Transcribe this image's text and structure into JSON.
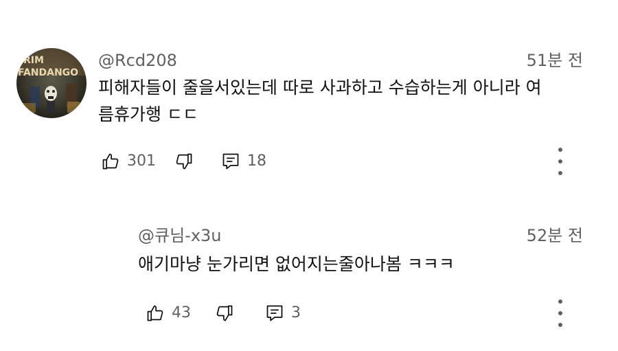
{
  "comments": [
    {
      "handle": "@Rcd208",
      "time": "51분 전",
      "text_line1": "피해자들이 줄을서있는데 따로 사과하고 수습하는게 아니라 여",
      "text_line2": "름휴가행 ㄷㄷ",
      "likes": "301",
      "replies": "18",
      "avatar_text": [
        "RIM",
        "FANDANGO"
      ]
    },
    {
      "handle": "@큐님-x3u",
      "time": "52분 전",
      "text_line1": "애기마냥 눈가리면 없어지는줄아나봄 ㅋㅋㅋ",
      "likes": "43",
      "replies": "3"
    }
  ],
  "icons": {
    "like": "thumbs-up-icon",
    "dislike": "thumbs-down-icon",
    "reply": "comment-icon",
    "more": "more-vertical-icon"
  },
  "colors": {
    "text_primary": "#0f0f0f",
    "text_secondary": "#606060",
    "background": "#ffffff"
  }
}
